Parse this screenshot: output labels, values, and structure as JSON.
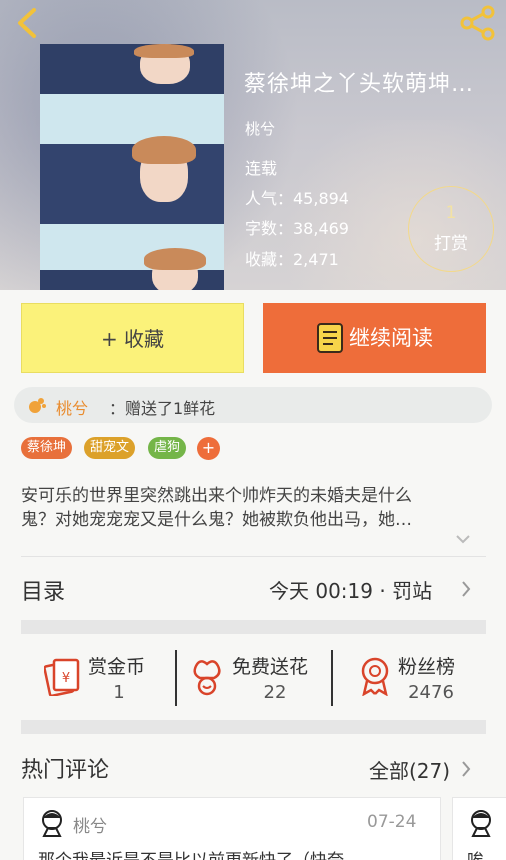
{
  "book": {
    "title": "蔡徐坤之丫头软萌坤…",
    "author": "桃兮",
    "status": "连载",
    "popularity": "人气：45,894",
    "words": "字数：38,469",
    "favorites": "收藏：2,471"
  },
  "tip": {
    "count": "1",
    "label": "打赏"
  },
  "actions": {
    "favorite_label": "+ 收藏",
    "read_label": "继续阅读"
  },
  "gift": {
    "from": "桃兮",
    "message": "：赠送了1鲜花"
  },
  "tags": [
    {
      "label": "蔡徐坤",
      "color": "#e8703b"
    },
    {
      "label": "甜宠文",
      "color": "#dca12a"
    },
    {
      "label": "虐狗",
      "color": "#74b548"
    }
  ],
  "tag_add": "+",
  "description": {
    "line1": "安可乐的世界里突然跳出来个帅炸天的未婚夫是什么",
    "line2": "鬼？对她宠宠宠又是什么鬼？她被欺负他出马，她…"
  },
  "toc": {
    "label": "目录",
    "latest": "今天 00:19 · 罚站"
  },
  "stats": {
    "reward": {
      "label": "赏金币",
      "value": "1"
    },
    "flowers": {
      "label": "免费送花",
      "value": "22"
    },
    "fans": {
      "label": "粉丝榜",
      "value": "2476"
    }
  },
  "comments": {
    "label": "热门评论",
    "all": "全部(27)",
    "items": [
      {
        "user": "桃兮",
        "date": "07-24",
        "text": "那个我最近是不是比以前更新快了（快夸"
      },
      {
        "text": "唉"
      }
    ]
  },
  "colors": {
    "accent": "#ee6d3a",
    "yellow": "#fbf27a",
    "gift_name": "#e98b2d"
  }
}
